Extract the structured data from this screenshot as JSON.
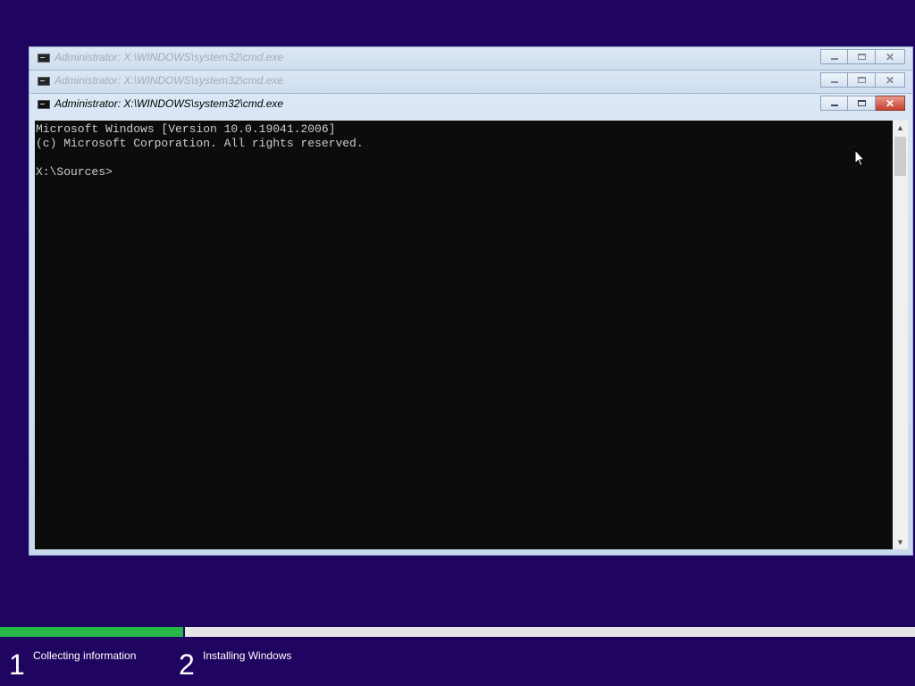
{
  "windows": {
    "background_1": {
      "title": "Administrator: X:\\WINDOWS\\system32\\cmd.exe"
    },
    "background_2": {
      "title": "Administrator: X:\\WINDOWS\\system32\\cmd.exe"
    },
    "main": {
      "title": "Administrator: X:\\WINDOWS\\system32\\cmd.exe",
      "console_text": "Microsoft Windows [Version 10.0.19041.2006]\n(c) Microsoft Corporation. All rights reserved.\n\nX:\\Sources>"
    }
  },
  "icons": {
    "app": "cmd-icon",
    "minimize": "minimize-icon",
    "maximize": "maximize-icon",
    "close": "close-icon",
    "close_glyph": "✕",
    "scroll_up_glyph": "▲",
    "scroll_down_glyph": "▼"
  },
  "setup_progress": {
    "fraction": 0.2,
    "steps": [
      {
        "number": "1",
        "label": "Collecting information"
      },
      {
        "number": "2",
        "label": "Installing Windows"
      }
    ]
  },
  "colors": {
    "background": "#1f0560",
    "progress_fill": "#27b74a",
    "progress_track": "#e6e6e6",
    "console_bg": "#0c0c0c",
    "close_button": "#c7402f"
  }
}
